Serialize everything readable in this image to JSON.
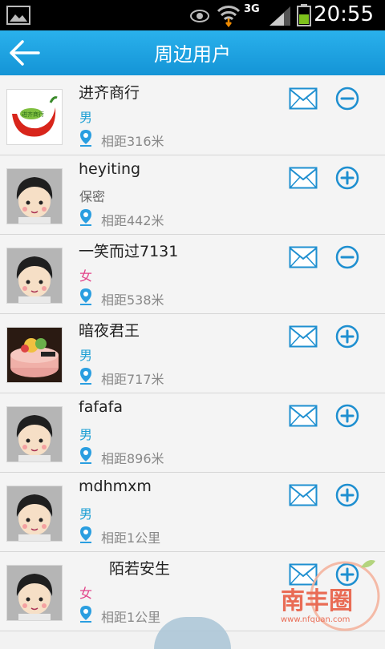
{
  "status_bar": {
    "network": "3G",
    "time": "20:55"
  },
  "header": {
    "title": "周边用户"
  },
  "users": [
    {
      "name": "进齐商行",
      "gender": "男",
      "gender_type": "male",
      "distance": "相距316米",
      "action": "remove",
      "avatar": "logo"
    },
    {
      "name": "heyiting",
      "gender": "保密",
      "gender_type": "secret",
      "distance": "相距442米",
      "action": "add",
      "avatar": "cartoon"
    },
    {
      "name": "一笑而过7131",
      "gender": "女",
      "gender_type": "female",
      "distance": "相距538米",
      "action": "remove",
      "avatar": "cartoon"
    },
    {
      "name": "暗夜君王",
      "gender": "男",
      "gender_type": "male",
      "distance": "相距717米",
      "action": "add",
      "avatar": "cake"
    },
    {
      "name": "fafafa",
      "gender": "男",
      "gender_type": "male",
      "distance": "相距896米",
      "action": "add",
      "avatar": "cartoon"
    },
    {
      "name": "mdhmxm",
      "gender": "男",
      "gender_type": "male",
      "distance": "相距1公里",
      "action": "add",
      "avatar": "cartoon"
    },
    {
      "name": "　　陌若安生",
      "gender": "女",
      "gender_type": "female",
      "distance": "相距1公里",
      "action": "add",
      "avatar": "cartoon"
    }
  ],
  "watermark": {
    "brand": "南丰圈",
    "url": "www.nfquan.com"
  },
  "colors": {
    "header": "#1ea3e2",
    "accent": "#1e8fd0",
    "male": "#1e9fd4",
    "female": "#e2458a"
  }
}
